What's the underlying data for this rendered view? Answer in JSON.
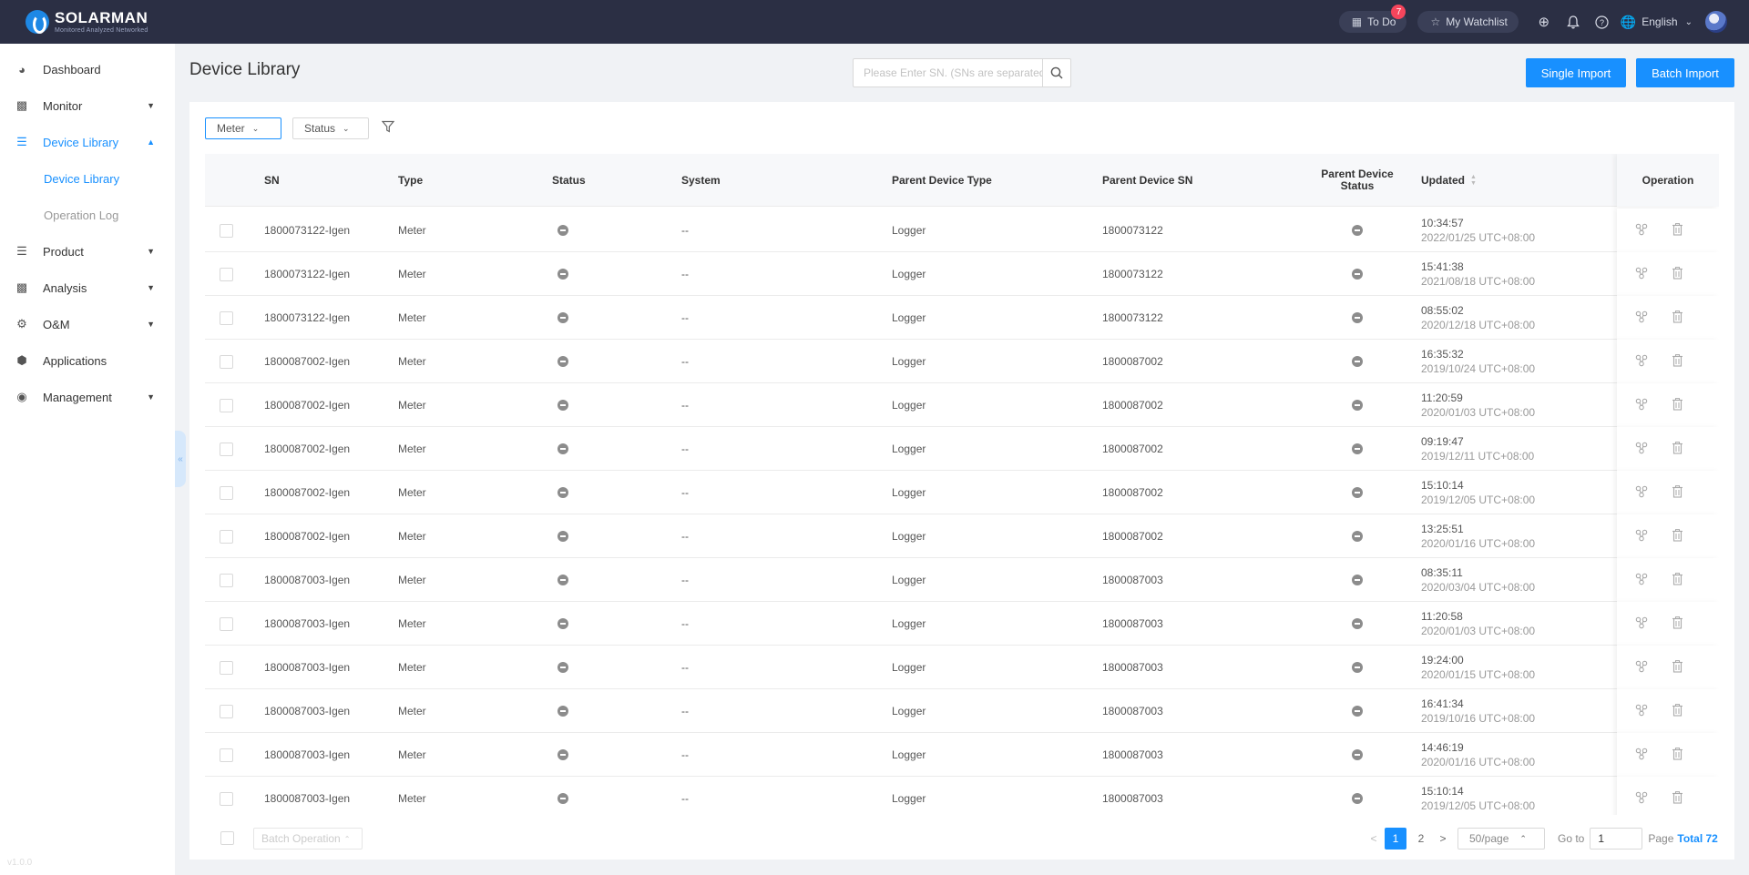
{
  "app": {
    "logo_name": "SOLARMAN",
    "logo_tagline": "Monitored Analyzed Networked"
  },
  "topbar": {
    "todo_label": "To Do",
    "todo_count": "7",
    "watchlist_label": "My Watchlist",
    "language": "English"
  },
  "sidebar": {
    "items": [
      {
        "label": "Dashboard",
        "icon": "dashboard-icon"
      },
      {
        "label": "Monitor",
        "icon": "monitor-icon"
      },
      {
        "label": "Device Library",
        "icon": "device-library-icon"
      },
      {
        "label": "Product",
        "icon": "product-icon"
      },
      {
        "label": "Analysis",
        "icon": "analysis-icon"
      },
      {
        "label": "O&M",
        "icon": "om-gear-icon"
      },
      {
        "label": "Applications",
        "icon": "applications-icon"
      },
      {
        "label": "Management",
        "icon": "management-icon"
      }
    ],
    "sub_items": [
      {
        "label": "Device Library"
      },
      {
        "label": "Operation Log"
      }
    ],
    "version": "v1.0.0"
  },
  "header": {
    "title": "Device Library",
    "search_placeholder": "Please Enter SN. (SNs are separated by commas)",
    "single_import": "Single Import",
    "batch_import": "Batch Import"
  },
  "filters": {
    "meter": "Meter",
    "status": "Status"
  },
  "table": {
    "columns": {
      "sn": "SN",
      "type": "Type",
      "status": "Status",
      "system": "System",
      "parent_type": "Parent Device Type",
      "parent_sn": "Parent Device SN",
      "parent_status_1": "Parent Device",
      "parent_status_2": "Status",
      "updated": "Updated",
      "operation": "Operation"
    },
    "rows": [
      {
        "sn": "1800073122-Igen",
        "type": "Meter",
        "system": "--",
        "parent_type": "Logger",
        "parent_sn": "1800073122",
        "time": "10:34:57",
        "date": "2022/01/25 UTC+08:00"
      },
      {
        "sn": "1800073122-Igen",
        "type": "Meter",
        "system": "--",
        "parent_type": "Logger",
        "parent_sn": "1800073122",
        "time": "15:41:38",
        "date": "2021/08/18 UTC+08:00"
      },
      {
        "sn": "1800073122-Igen",
        "type": "Meter",
        "system": "--",
        "parent_type": "Logger",
        "parent_sn": "1800073122",
        "time": "08:55:02",
        "date": "2020/12/18 UTC+08:00"
      },
      {
        "sn": "1800087002-Igen",
        "type": "Meter",
        "system": "--",
        "parent_type": "Logger",
        "parent_sn": "1800087002",
        "time": "16:35:32",
        "date": "2019/10/24 UTC+08:00"
      },
      {
        "sn": "1800087002-Igen",
        "type": "Meter",
        "system": "--",
        "parent_type": "Logger",
        "parent_sn": "1800087002",
        "time": "11:20:59",
        "date": "2020/01/03 UTC+08:00"
      },
      {
        "sn": "1800087002-Igen",
        "type": "Meter",
        "system": "--",
        "parent_type": "Logger",
        "parent_sn": "1800087002",
        "time": "09:19:47",
        "date": "2019/12/11 UTC+08:00"
      },
      {
        "sn": "1800087002-Igen",
        "type": "Meter",
        "system": "--",
        "parent_type": "Logger",
        "parent_sn": "1800087002",
        "time": "15:10:14",
        "date": "2019/12/05 UTC+08:00"
      },
      {
        "sn": "1800087002-Igen",
        "type": "Meter",
        "system": "--",
        "parent_type": "Logger",
        "parent_sn": "1800087002",
        "time": "13:25:51",
        "date": "2020/01/16 UTC+08:00"
      },
      {
        "sn": "1800087003-Igen",
        "type": "Meter",
        "system": "--",
        "parent_type": "Logger",
        "parent_sn": "1800087003",
        "time": "08:35:11",
        "date": "2020/03/04 UTC+08:00"
      },
      {
        "sn": "1800087003-Igen",
        "type": "Meter",
        "system": "--",
        "parent_type": "Logger",
        "parent_sn": "1800087003",
        "time": "11:20:58",
        "date": "2020/01/03 UTC+08:00"
      },
      {
        "sn": "1800087003-Igen",
        "type": "Meter",
        "system": "--",
        "parent_type": "Logger",
        "parent_sn": "1800087003",
        "time": "19:24:00",
        "date": "2020/01/15 UTC+08:00"
      },
      {
        "sn": "1800087003-Igen",
        "type": "Meter",
        "system": "--",
        "parent_type": "Logger",
        "parent_sn": "1800087003",
        "time": "16:41:34",
        "date": "2019/10/16 UTC+08:00"
      },
      {
        "sn": "1800087003-Igen",
        "type": "Meter",
        "system": "--",
        "parent_type": "Logger",
        "parent_sn": "1800087003",
        "time": "14:46:19",
        "date": "2020/01/16 UTC+08:00"
      },
      {
        "sn": "1800087003-Igen",
        "type": "Meter",
        "system": "--",
        "parent_type": "Logger",
        "parent_sn": "1800087003",
        "time": "15:10:14",
        "date": "2019/12/05 UTC+08:00"
      }
    ]
  },
  "footer": {
    "batch_operation": "Batch Operation",
    "page_1": "1",
    "page_2": "2",
    "page_size": "50/page",
    "goto_label": "Go to",
    "goto_value": "1",
    "page_label": "Page",
    "total": "Total 72"
  },
  "colors": {
    "topbar": "#2b2f44",
    "accent": "#1890ff",
    "badge": "#f5455c"
  }
}
